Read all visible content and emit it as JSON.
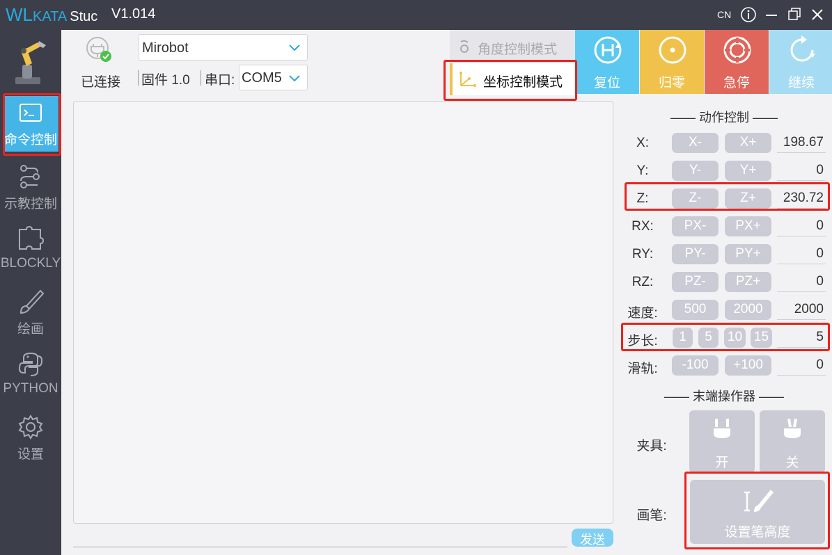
{
  "titlebar": {
    "brand_wl": "WL",
    "brand_kata": "KATA",
    "brand_stu": "Stuc",
    "version": "V1.014",
    "language": "CN"
  },
  "sidebar": {
    "items": [
      {
        "label": "命令控制",
        "icon": "terminal-icon"
      },
      {
        "label": "示教控制",
        "icon": "flow-icon"
      },
      {
        "label": "BLOCKLY",
        "icon": "puzzle-icon"
      },
      {
        "label": "绘画",
        "icon": "brush-icon"
      },
      {
        "label": "PYTHON",
        "icon": "python-icon"
      },
      {
        "label": "设置",
        "icon": "gear-icon"
      }
    ]
  },
  "connection": {
    "status": "已连接",
    "robot_model": "Mirobot",
    "firmware_label": "固件",
    "firmware_version": "1.0",
    "port_label": "串口:",
    "port_value": "COM5"
  },
  "modes": {
    "angle": "角度控制模式",
    "coord": "坐标控制模式"
  },
  "actions": {
    "home": "复位",
    "zero": "归零",
    "estop": "急停",
    "resume": "继续"
  },
  "console": {
    "send_label": "发送"
  },
  "motion": {
    "title": "—— 动作控制 ——",
    "rows": [
      {
        "label": "X:",
        "minus": "X-",
        "plus": "X+",
        "value": "198.67"
      },
      {
        "label": "Y:",
        "minus": "Y-",
        "plus": "Y+",
        "value": "0"
      },
      {
        "label": "Z:",
        "minus": "Z-",
        "plus": "Z+",
        "value": "230.72"
      },
      {
        "label": "RX:",
        "minus": "PX-",
        "plus": "PX+",
        "value": "0"
      },
      {
        "label": "RY:",
        "minus": "PY-",
        "plus": "PY+",
        "value": "0"
      },
      {
        "label": "RZ:",
        "minus": "PZ-",
        "plus": "PZ+",
        "value": "0"
      }
    ],
    "speed": {
      "label": "速度:",
      "opt1": "500",
      "opt2": "2000",
      "value": "2000"
    },
    "step": {
      "label": "步长:",
      "options": [
        "1",
        "5",
        "10",
        "15"
      ],
      "value": "5"
    },
    "rail": {
      "label": "滑轨:",
      "minus": "-100",
      "plus": "+100",
      "value": "0"
    }
  },
  "effector": {
    "title": "—— 末端操作器 ——",
    "gripper_label": "夹具:",
    "gripper_open": "开",
    "gripper_close": "关",
    "pen_label": "画笔:",
    "pen_height": "设置笔高度"
  },
  "colors": {
    "accent": "#45b5e8",
    "home": "#5ac8f0",
    "zero": "#f0c24b",
    "estop": "#e0655a",
    "resume": "#a6dcf3",
    "highlight": "#e8231f"
  }
}
